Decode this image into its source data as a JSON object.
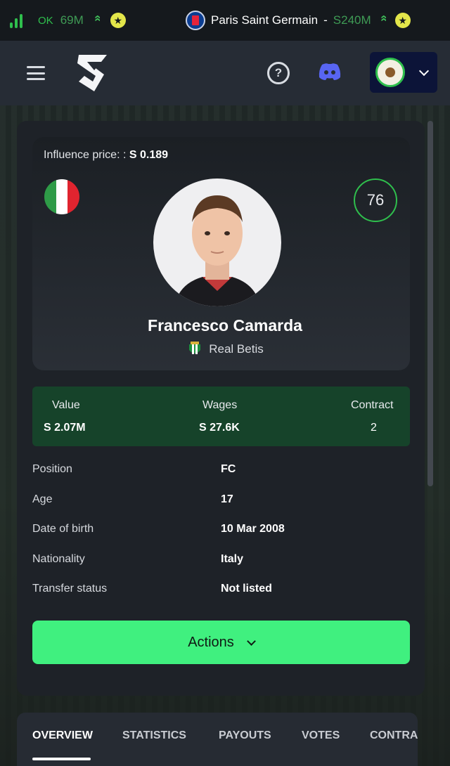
{
  "topbar": {
    "status": "OK",
    "budget": "69M",
    "club_name": "Paris Saint Germain",
    "separator": "-",
    "club_value": "240M",
    "currency_symbol": "S"
  },
  "header": {
    "menu_icon": "hamburger-icon",
    "logo_icon": "sorare-s-logo",
    "help_icon": "question-icon",
    "discord_icon": "discord-icon"
  },
  "player": {
    "influence_label": "Influence price: :",
    "influence_value": "0.189",
    "rating": "76",
    "name": "Francesco Camarda",
    "club": "Real Betis",
    "flag_colors": [
      "#2e9b47",
      "#ffffff",
      "#e0242f"
    ]
  },
  "stats": {
    "value_label": "Value",
    "value": "2.07M",
    "wages_label": "Wages",
    "wages": "27.6K",
    "contract_label": "Contract",
    "contract": "2"
  },
  "details": [
    {
      "label": "Position",
      "value": "FC"
    },
    {
      "label": "Age",
      "value": "17"
    },
    {
      "label": "Date of birth",
      "value": "10 Mar 2008"
    },
    {
      "label": "Nationality",
      "value": "Italy"
    },
    {
      "label": "Transfer status",
      "value": "Not listed"
    }
  ],
  "actions_label": "Actions",
  "tabs": [
    "OVERVIEW",
    "STATISTICS",
    "PAYOUTS",
    "VOTES",
    "CONTRA"
  ],
  "colors": {
    "accent_green": "#40f07f",
    "stats_bg": "#16432a",
    "rating_ring": "#2fbf4d"
  }
}
